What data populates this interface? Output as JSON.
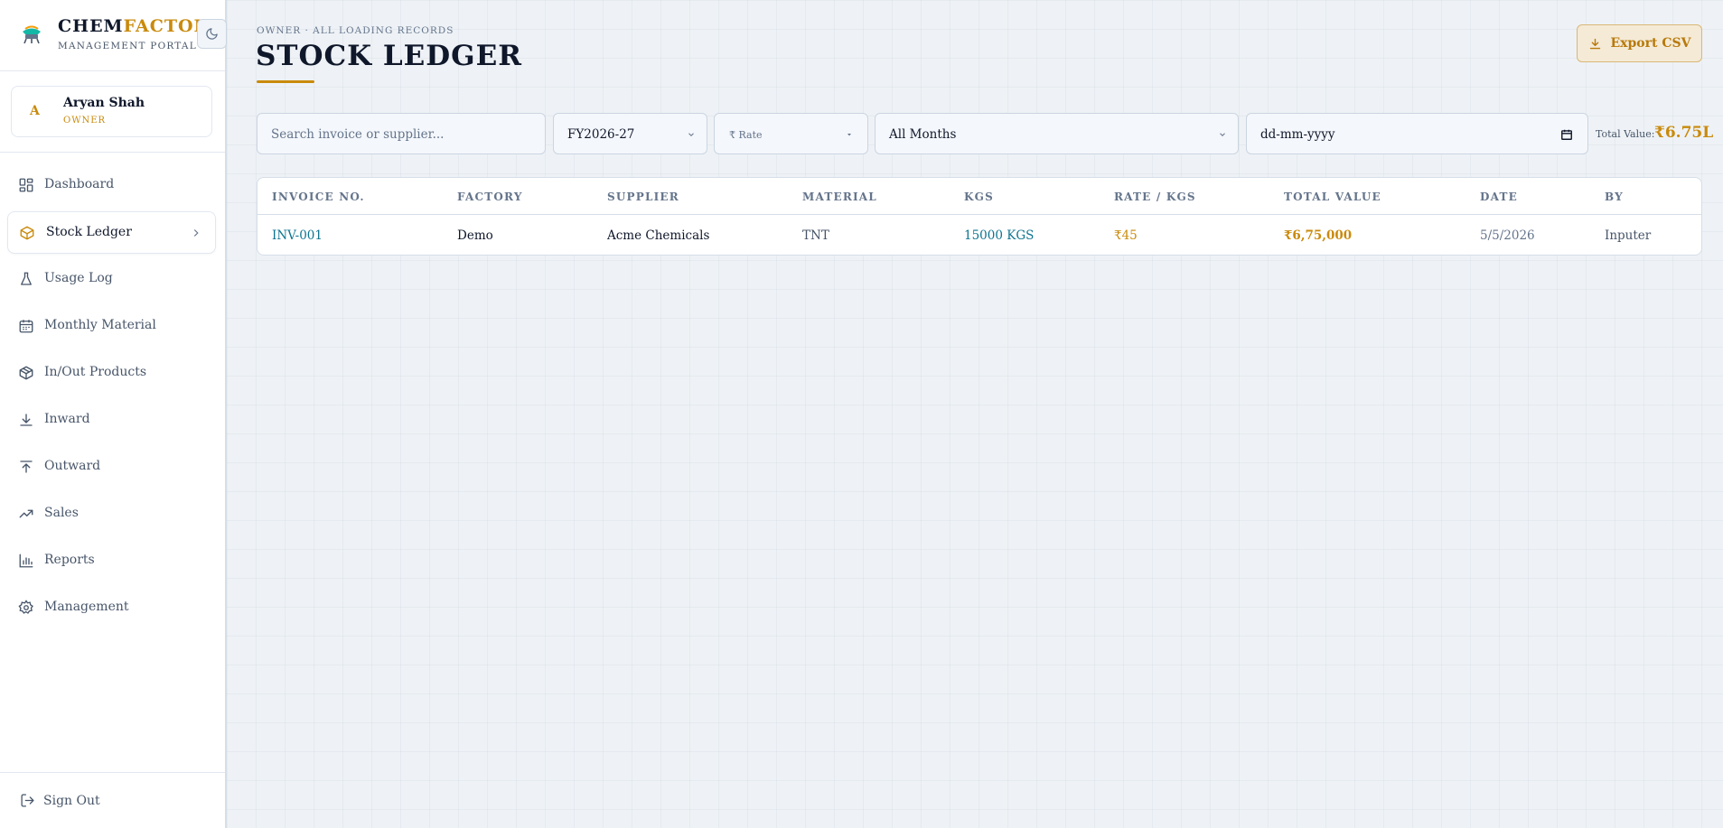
{
  "brand": {
    "name_part1": "CHEM",
    "name_part2": "FACTORY",
    "subtitle": "MANAGEMENT PORTAL"
  },
  "user": {
    "initial": "A",
    "name": "Aryan Shah",
    "role": "OWNER"
  },
  "nav": {
    "items": [
      {
        "label": "Dashboard",
        "icon": "dashboard-icon"
      },
      {
        "label": "Stock Ledger",
        "icon": "box-icon",
        "active": true
      },
      {
        "label": "Usage Log",
        "icon": "flask-icon"
      },
      {
        "label": "Monthly Material",
        "icon": "calendar-icon"
      },
      {
        "label": "In/Out Products",
        "icon": "package-icon"
      },
      {
        "label": "Inward",
        "icon": "arrow-down-icon"
      },
      {
        "label": "Outward",
        "icon": "arrow-up-icon"
      },
      {
        "label": "Sales",
        "icon": "trending-up-icon"
      },
      {
        "label": "Reports",
        "icon": "bar-chart-icon"
      },
      {
        "label": "Management",
        "icon": "gear-icon"
      }
    ],
    "signout": "Sign Out"
  },
  "page": {
    "breadcrumb": "OWNER · ALL LOADING RECORDS",
    "title": "STOCK LEDGER",
    "export_label": "Export CSV"
  },
  "filters": {
    "search_placeholder": "Search invoice or supplier...",
    "fy": "FY2026-27",
    "rate": "₹ Rate",
    "month": "All Months",
    "date_placeholder": "dd-mm-yyyy",
    "total_label": "Total Value:",
    "total_value": "₹6.75L"
  },
  "table": {
    "headers": [
      "INVOICE NO.",
      "FACTORY",
      "SUPPLIER",
      "MATERIAL",
      "KGS",
      "RATE / KGS",
      "TOTAL VALUE",
      "DATE",
      "BY"
    ],
    "rows": [
      [
        "INV-001",
        "Demo",
        "Acme Chemicals",
        "TNT",
        "15000 KGS",
        "₹45",
        "₹6,75,000",
        "5/5/2026",
        "Inputer"
      ]
    ]
  },
  "colors": {
    "accent": "#c98a0c",
    "link": "#0e7490",
    "text": "#0f172a",
    "muted": "#64748b"
  }
}
